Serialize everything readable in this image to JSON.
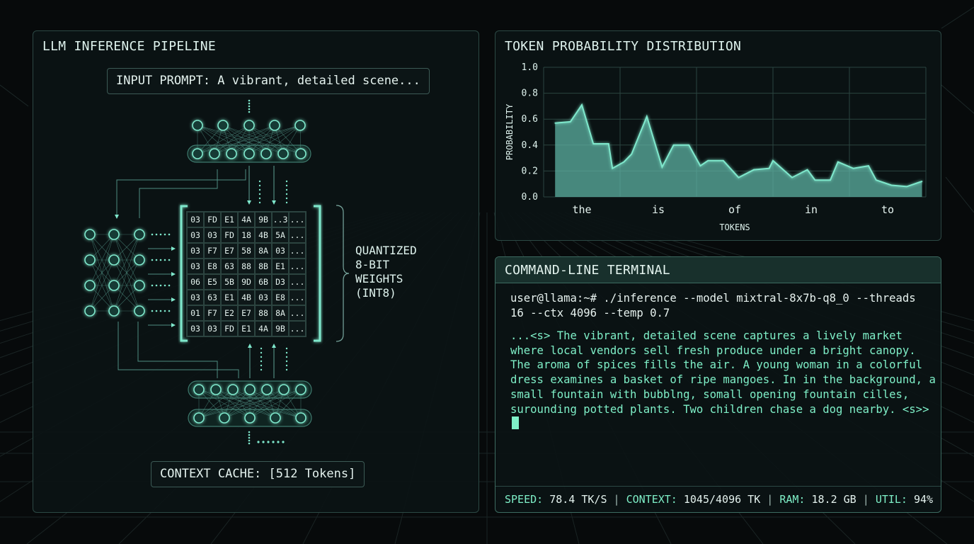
{
  "pipeline": {
    "title": "LLM INFERENCE PIPELINE",
    "input_prompt": "INPUT PROMPT: A vibrant, detailed scene...",
    "context_cache": "CONTEXT CACHE: [512 Tokens]",
    "quantized_label": [
      "QUANTIZED",
      "8-BIT",
      "WEIGHTS",
      "(INT8)"
    ],
    "weights": [
      [
        "03",
        "FD",
        "E1",
        "4A",
        "9B",
        "..3",
        "..."
      ],
      [
        "03",
        "03",
        "FD",
        "18",
        "4B",
        "5A",
        "..."
      ],
      [
        "03",
        "F7",
        "E7",
        "58",
        "8A",
        "03",
        "..."
      ],
      [
        "03",
        "E8",
        "63",
        "88",
        "8B",
        "E1",
        "..."
      ],
      [
        "06",
        "E5",
        "5B",
        "9D",
        "6B",
        "D3",
        "..."
      ],
      [
        "03",
        "63",
        "E1",
        "4B",
        "03",
        "E8",
        "..."
      ],
      [
        "01",
        "F7",
        "E2",
        "E7",
        "88",
        "8A",
        "..."
      ],
      [
        "03",
        "03",
        "FD",
        "E1",
        "4A",
        "9B",
        "..."
      ]
    ],
    "accent_color": "#7fe8cc"
  },
  "chart_data": {
    "type": "area",
    "title": "TOKEN PROBABILITY DISTRIBUTION",
    "xlabel": "TOKENS",
    "ylabel": "PROBABILITY",
    "ylim": [
      0,
      1.0
    ],
    "y_ticks": [
      "1.0",
      "0.8",
      "0.6",
      "0.4",
      "0.2",
      "0.0"
    ],
    "categories": [
      "the",
      "is",
      "of",
      "in",
      "to"
    ],
    "x_range": [
      0,
      5
    ],
    "grid": true,
    "series": [
      {
        "points": [
          [
            0.15,
            0.57
          ],
          [
            0.35,
            0.58
          ],
          [
            0.5,
            0.71
          ],
          [
            0.65,
            0.41
          ],
          [
            0.85,
            0.41
          ],
          [
            0.9,
            0.22
          ],
          [
            1.05,
            0.27
          ],
          [
            1.15,
            0.33
          ],
          [
            1.35,
            0.62
          ],
          [
            1.55,
            0.23
          ],
          [
            1.7,
            0.4
          ],
          [
            1.9,
            0.4
          ],
          [
            2.05,
            0.24
          ],
          [
            2.15,
            0.28
          ],
          [
            2.35,
            0.28
          ],
          [
            2.55,
            0.15
          ],
          [
            2.75,
            0.21
          ],
          [
            2.95,
            0.22
          ],
          [
            3.0,
            0.28
          ],
          [
            3.25,
            0.15
          ],
          [
            3.45,
            0.21
          ],
          [
            3.55,
            0.13
          ],
          [
            3.75,
            0.13
          ],
          [
            3.85,
            0.27
          ],
          [
            4.05,
            0.22
          ],
          [
            4.25,
            0.24
          ],
          [
            4.35,
            0.13
          ],
          [
            4.55,
            0.09
          ],
          [
            4.75,
            0.08
          ],
          [
            4.95,
            0.12
          ]
        ]
      }
    ],
    "line_color": "#7fe8cc",
    "fill_color": "#5fb5a6"
  },
  "terminal": {
    "title": "COMMAND-LINE TERMINAL",
    "command": "user@llama:~# ./inference --model mixtral-8x7b-q8_0 --threads 16 --ctx 4096 --temp 0.7",
    "output": "...<s> The vibrant, detailed scene captures a lively market where local vendors sell fresh produce under a bright canopy. The aroma of spices fills the air. A young woman in a colorful dress examines a basket of ripe mangoes. In in the background, a small fountain with bubblng, somall opening fountain cilles, surounding potted plants. Two children chase a dog nearby. <s>>",
    "output_color": "#7ff0c8"
  },
  "status": {
    "speed_label": "SPEED:",
    "speed_value": "78.4 TK/S",
    "context_label": "CONTEXT:",
    "context_value": "1045/4096 TK",
    "ram_label": "RAM:",
    "ram_value": "18.2 GB",
    "util_label": "UTIL:",
    "util_value": "94%",
    "separator": "|"
  }
}
